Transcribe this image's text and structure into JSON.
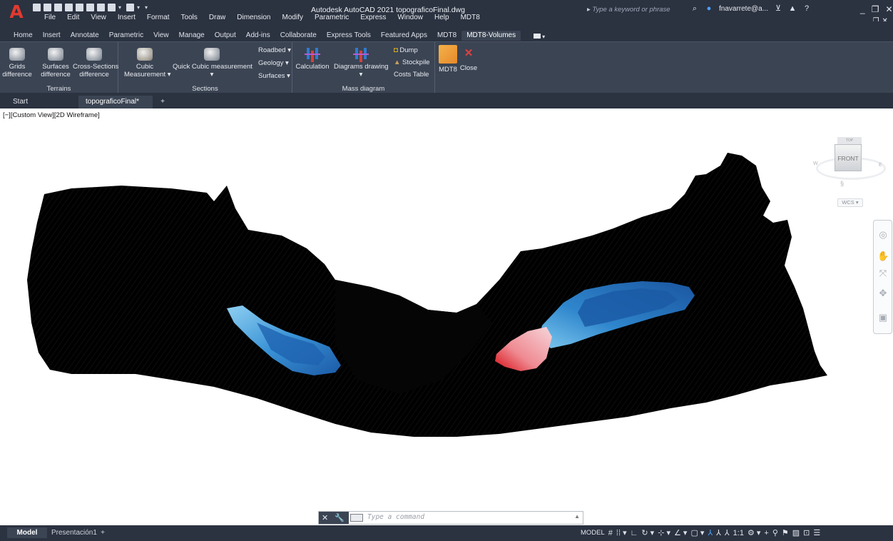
{
  "app": {
    "title": "Autodesk AutoCAD 2021   topograficoFinal.dwg",
    "search_placeholder": "Type a keyword or phrase",
    "user": "fnavarrete@a...",
    "logo_letter": "A"
  },
  "menu": [
    "File",
    "Edit",
    "View",
    "Insert",
    "Format",
    "Tools",
    "Draw",
    "Dimension",
    "Modify",
    "Parametric",
    "Express",
    "Window",
    "Help",
    "MDT8"
  ],
  "ribbon_tabs": [
    "Home",
    "Insert",
    "Annotate",
    "Parametric",
    "View",
    "Manage",
    "Output",
    "Add-ins",
    "Collaborate",
    "Express Tools",
    "Featured Apps",
    "MDT8",
    "MDT8-Volumes"
  ],
  "active_tab": "MDT8-Volumes",
  "ribbon": {
    "terrains": {
      "title": "Terrains",
      "grids_l1": "Grids",
      "grids_l2": "difference",
      "surfaces_l1": "Surfaces",
      "surfaces_l2": "difference",
      "cross_l1": "Cross-Sections",
      "cross_l2": "difference"
    },
    "sections": {
      "title": "Sections",
      "cubic_l1": "Cubic",
      "cubic_l2": "Measurement",
      "quick": "Quick Cubic measurement",
      "roadbed": "Roadbed",
      "geology": "Geology",
      "surfaces": "Surfaces"
    },
    "mass": {
      "title": "Mass diagram",
      "calculation": "Calculation",
      "diagrams": "Diagrams drawing",
      "dump": "Dump",
      "stockpile": "Stockpile",
      "costs": "Costs Table"
    },
    "mdt8": {
      "label": "MDT8",
      "close": "Close"
    }
  },
  "doc_tabs": {
    "start": "Start",
    "file": "topograficoFinal*"
  },
  "viewport": {
    "label": "[−][Custom View][2D Wireframe]"
  },
  "viewcube": {
    "top": "TOP",
    "front": "FRONT",
    "west": "W",
    "east": "E",
    "wcs": "WCS"
  },
  "command": {
    "placeholder": "Type a command"
  },
  "layout_tabs": {
    "model": "Model",
    "presentation": "Presentación1"
  },
  "status": {
    "model": "MODEL",
    "scale": "1:1"
  },
  "colors": {
    "ui_dark": "#2b3240",
    "ribbon_bg": "#3b4453",
    "terrain": "#000000",
    "fill_blue": "#1f6fb8",
    "fill_red": "#e11a1a"
  }
}
